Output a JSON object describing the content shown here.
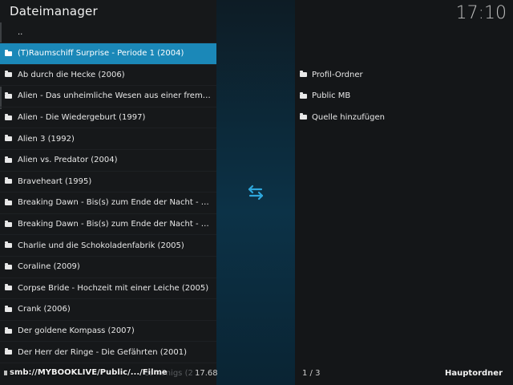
{
  "header": {
    "title": "Dateimanager",
    "clock": "17:10"
  },
  "left_list": {
    "items": [
      {
        "label": "..",
        "type": "updir"
      },
      {
        "label": "(T)Raumschiff Surprise - Periode 1 (2004)",
        "selected": true
      },
      {
        "label": "Ab durch die Hecke (2006)"
      },
      {
        "label": "Alien - Das unheimliche Wesen aus einer fremden…"
      },
      {
        "label": "Alien - Die Wiedergeburt (1997)"
      },
      {
        "label": "Alien 3 (1992)"
      },
      {
        "label": "Alien vs. Predator (2004)"
      },
      {
        "label": "Braveheart (1995)"
      },
      {
        "label": "Breaking Dawn - Bis(s) zum Ende der Nacht - Teil …"
      },
      {
        "label": "Breaking Dawn - Bis(s) zum Ende der Nacht - Teil …"
      },
      {
        "label": "Charlie und die Schokoladenfabrik (2005)"
      },
      {
        "label": "Coraline (2009)"
      },
      {
        "label": "Corpse Bride - Hochzeit mit einer Leiche (2005)"
      },
      {
        "label": "Crank (2006)"
      },
      {
        "label": "Der goldene Kompass (2007)"
      },
      {
        "label": "Der Herr der Ringe - Die Gefährten (2001)"
      }
    ]
  },
  "right_list": {
    "items": [
      {
        "label": "Profil-Ordner"
      },
      {
        "label": "Public MB"
      },
      {
        "label": "Quelle hinzufügen"
      }
    ]
  },
  "footer": {
    "path": "smb://MYBOOKLIVE/Public/.../Filme",
    "ghost_text": "es Königs (2",
    "size": "17.68",
    "pager": "1 / 3",
    "root_label": "Hauptordner"
  },
  "icons": {
    "folder": "folder-icon",
    "swap": "swap-arrows-icon"
  },
  "colors": {
    "selection": "#1b88b8",
    "accent": "#2ea7dc"
  }
}
